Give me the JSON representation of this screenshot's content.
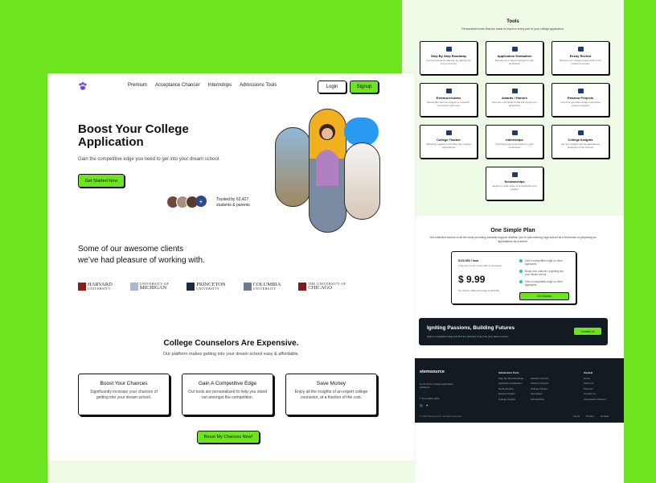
{
  "colors": {
    "accent": "#6ee31f",
    "dark": "#121a22",
    "navy": "#1a3a7a"
  },
  "nav": {
    "items": [
      "Premium",
      "Acceptance Chancer",
      "Internships",
      "Admissions Tools"
    ],
    "login": "Login",
    "signup": "Signup"
  },
  "hero": {
    "title": "Boost Your College Application",
    "subtitle": "Gain the competitive edge you need to get into your dream school.",
    "cta": "Get Started Now",
    "plus": "+",
    "trusted_line1": "Trusted by 62,427",
    "trusted_line2": "students & parents"
  },
  "clients": {
    "title_line1": "Some of our awesome clients",
    "title_line2": "we’ve had pleasure of working with.",
    "logos": [
      {
        "line1": "HARVARD",
        "line2": "UNIVERSITY"
      },
      {
        "line1": "UNIVERSITY OF",
        "line2": "MICHIGAN"
      },
      {
        "line1": "PRINCETON",
        "line2": "UNIVERSITY"
      },
      {
        "line1": "COLUMBIA",
        "line2": "UNIVERSITY"
      },
      {
        "line1": "THE UNIVERSITY OF",
        "line2": "CHICAGO"
      }
    ]
  },
  "counselors": {
    "title": "College Counselors Are Expensive.",
    "subtitle": "Our platform makes getting into your dream school easy & affordable.",
    "cards": [
      {
        "title": "Boost Your Chances",
        "text": "Significantly increase your chances of getting into your dream school."
      },
      {
        "title": "Gain A Competitive Edge",
        "text": "Our tools are personalized to help you stand out amongst the competition."
      },
      {
        "title": "Save Money",
        "text": "Enjoy all the insights of an expert college counselor, at a fraction of the cost."
      }
    ],
    "cta": "Boost My Chances Now!"
  },
  "tools": {
    "title": "Tools",
    "subtitle": "Personalized tools that are made to improve every part of your college application.",
    "items": [
      {
        "title": "Step By Step Roadmap",
        "desc": "A comprehensive roadmap for getting into a top university"
      },
      {
        "title": "Application Evaluation",
        "desc": "Receive an in-depth analysis of your application"
      },
      {
        "title": "Essay Review",
        "desc": "Review your college essays with an AI-powered reviewer"
      },
      {
        "title": "Extracurriculars",
        "desc": "Meaningful summer programs, research, internships and more"
      },
      {
        "title": "Awards / Honors",
        "desc": "Discover competitions that will propel your application"
      },
      {
        "title": "Passion Projects",
        "desc": "Use AI to generate unique impressive passion projects"
      },
      {
        "title": "College Tracker",
        "desc": "Efficiently organize and track your college applications"
      },
      {
        "title": "Internships",
        "desc": "Find high-paying internships to gain experience"
      },
      {
        "title": "College Insights",
        "desc": "Get key insights into the admissions strategies of top schools"
      },
      {
        "title": "Scholarships",
        "desc": "Explore a wide range of scholarships and awards"
      }
    ]
  },
  "plan": {
    "title": "One Simple Plan",
    "subtitle": "Get unlimited access to all the tools providing valuable support whether you’re just entering high school as a freshman or preparing for applications as a senior.",
    "line1": "$120-500 / hour",
    "line2": "(The cost of just 1 hour with a counselor)",
    "price": "$ 9.99",
    "line3": "Per Month / Billed Annually at $119.88",
    "features": [
      "Gain a competitive edge on other applicants",
      "Boost your chances of getting into your dream school",
      "Gain a competitive edge on other applicants"
    ],
    "button": "Get Started"
  },
  "cta_banner": {
    "title": "Igniting Passions, Building Futures",
    "subtitle": "Gain a competitive edge and find the attention to get into your dream school.",
    "button": "Contact Us"
  },
  "footer": {
    "brand": "stemsource",
    "desc": "An AI-driven college application guidance...",
    "copy1": "© PromoBox 2023",
    "copy2": "© 2023 Stemsource. All rights reserved.",
    "col1_head": "Admissions Tools",
    "col1": [
      "Step By Step Roadmap",
      "Application Evaluation",
      "Essay Review",
      "Extracurriculars",
      "College Insights"
    ],
    "col2": [
      "Awards / Honors",
      "Passion Projects",
      "College Tracker",
      "Internships",
      "Scholarships"
    ],
    "col3_head": "General",
    "col3": [
      "Home",
      "About Us",
      "Premium",
      "Contact Us",
      "Acceptance Chancer"
    ],
    "bottom": [
      "Terms",
      "Privacy",
      "Contact"
    ]
  }
}
